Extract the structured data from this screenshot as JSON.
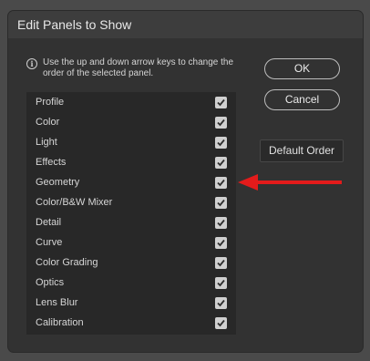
{
  "dialog": {
    "title": "Edit Panels to Show",
    "info_icon": "info-icon",
    "info_text": "Use the up and down arrow keys to change the order of the selected panel."
  },
  "panels": [
    {
      "label": "Profile",
      "checked": true
    },
    {
      "label": "Color",
      "checked": true
    },
    {
      "label": "Light",
      "checked": true
    },
    {
      "label": "Effects",
      "checked": true
    },
    {
      "label": "Geometry",
      "checked": true
    },
    {
      "label": "Color/B&W Mixer",
      "checked": true
    },
    {
      "label": "Detail",
      "checked": true
    },
    {
      "label": "Curve",
      "checked": true
    },
    {
      "label": "Color Grading",
      "checked": true
    },
    {
      "label": "Optics",
      "checked": true
    },
    {
      "label": "Lens Blur",
      "checked": true
    },
    {
      "label": "Calibration",
      "checked": true
    }
  ],
  "buttons": {
    "ok": "OK",
    "cancel": "Cancel",
    "default_order": "Default Order"
  },
  "annotation": {
    "arrow_color": "#e31b1b",
    "points_to": "Geometry"
  },
  "colors": {
    "dialog_bg": "#323232",
    "list_bg": "#282828",
    "checkbox": "#d0d0d0"
  }
}
